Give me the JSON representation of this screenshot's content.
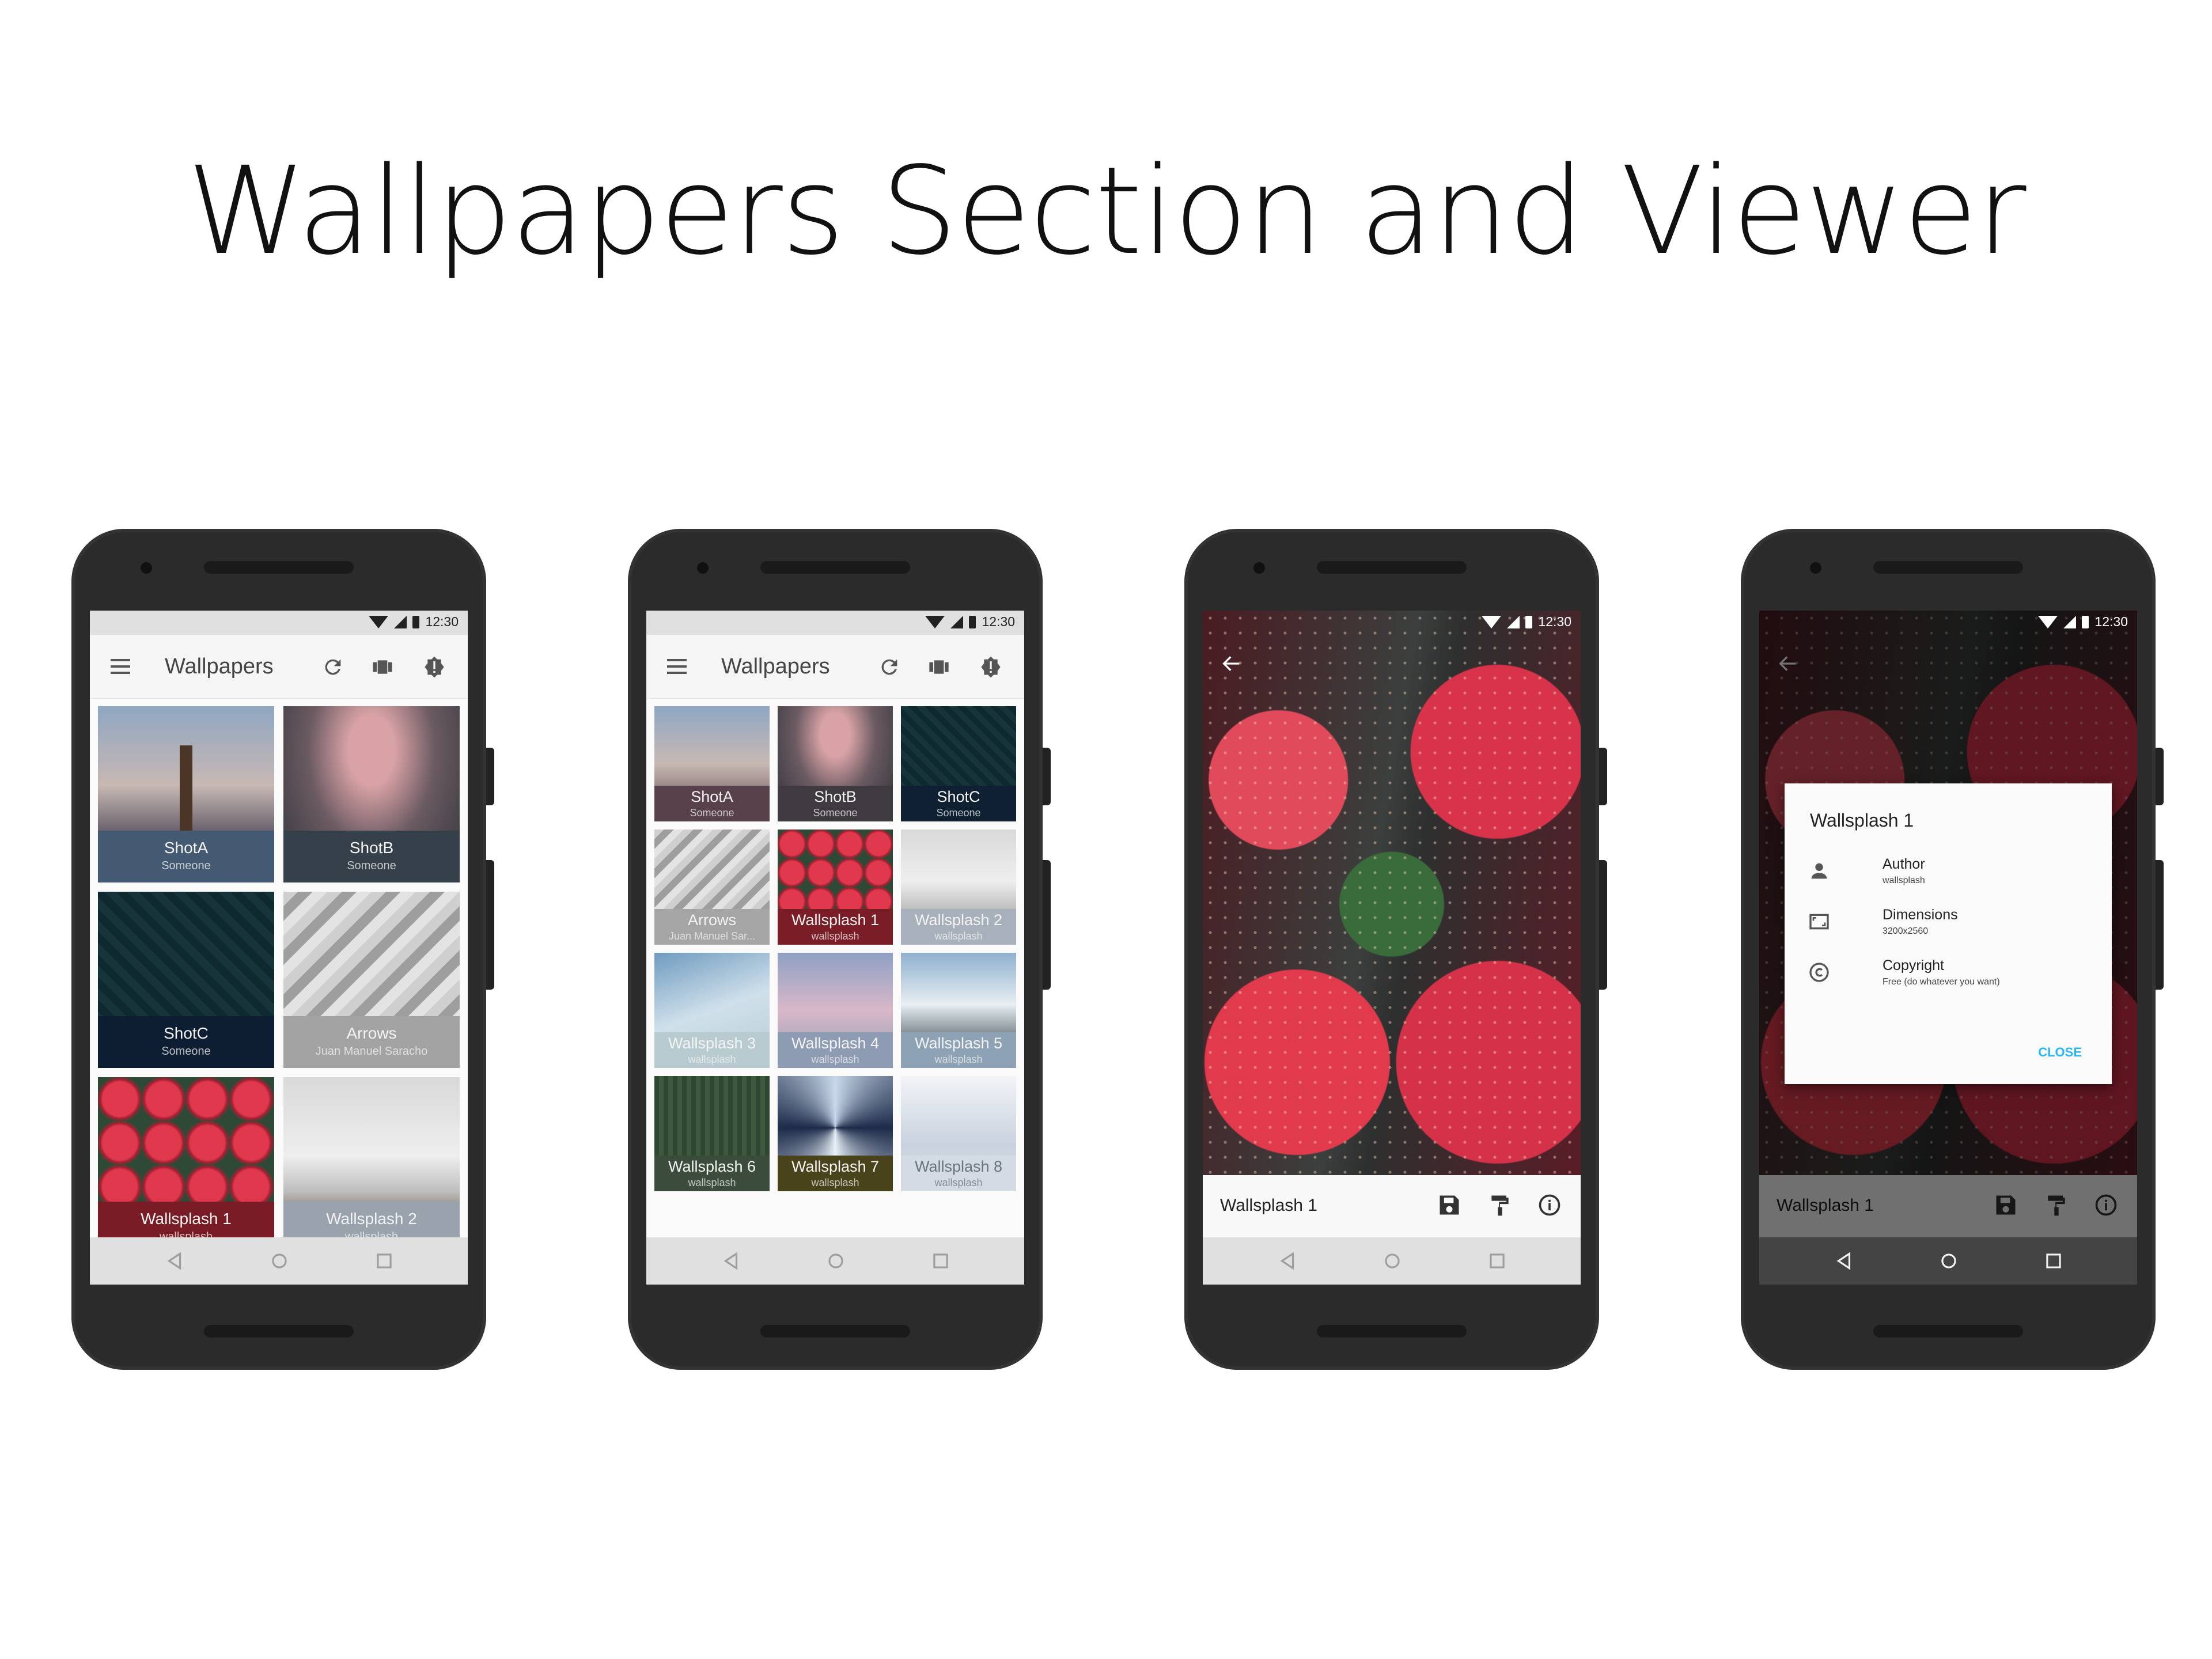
{
  "page_title": "Wallpapers Section and Viewer",
  "status": {
    "time": "12:30"
  },
  "appbar": {
    "title": "Wallpapers"
  },
  "grid_two_columns": [
    {
      "title": "ShotA",
      "subtitle": "Someone",
      "image": "city-dusk-tower",
      "color": "#445a72"
    },
    {
      "title": "ShotB",
      "subtitle": "Someone",
      "image": "night-sky-glow",
      "color": "#36404a"
    },
    {
      "title": "ShotC",
      "subtitle": "Someone",
      "image": "aerial-city-dark",
      "color": "#0d1e33"
    },
    {
      "title": "Arrows",
      "subtitle": "Juan Manuel Saracho",
      "image": "gray-chevron-pattern",
      "color": "#a3a3a3"
    },
    {
      "title": "Wallsplash 1",
      "subtitle": "wallsplash",
      "image": "strawberries",
      "color": "#7a1c25"
    },
    {
      "title": "Wallsplash 2",
      "subtitle": "wallsplash",
      "image": "misty-mountain",
      "color": "#9aa3ad"
    }
  ],
  "grid_three_columns": [
    {
      "title": "ShotA",
      "subtitle": "Someone",
      "image": "city-dusk-tower",
      "color": "#58414a"
    },
    {
      "title": "ShotB",
      "subtitle": "Someone",
      "image": "night-sky-glow",
      "color": "#3e3a3f"
    },
    {
      "title": "ShotC",
      "subtitle": "Someone",
      "image": "aerial-city-dark",
      "color": "#0e2031"
    },
    {
      "title": "Arrows",
      "subtitle": "Juan Manuel Sar...",
      "image": "gray-chevron-pattern",
      "color": "#a5a5a5"
    },
    {
      "title": "Wallsplash 1",
      "subtitle": "wallsplash",
      "image": "strawberries",
      "color": "#7b1d27"
    },
    {
      "title": "Wallsplash 2",
      "subtitle": "wallsplash",
      "image": "misty-mountain",
      "color": "#a8b1bb"
    },
    {
      "title": "Wallsplash 3",
      "subtitle": "wallsplash",
      "image": "blue-sky-clouds",
      "color": "#b7cbd1"
    },
    {
      "title": "Wallsplash 4",
      "subtitle": "wallsplash",
      "image": "pink-clouds",
      "color": "#8d9bb3"
    },
    {
      "title": "Wallsplash 5",
      "subtitle": "wallsplash",
      "image": "snowy-peaks",
      "color": "#8da2b4"
    },
    {
      "title": "Wallsplash 6",
      "subtitle": "wallsplash",
      "image": "forest",
      "color": "#3b4b3c"
    },
    {
      "title": "Wallsplash 7",
      "subtitle": "wallsplash",
      "image": "glass-roof",
      "color": "#49431b"
    },
    {
      "title": "Wallsplash 8",
      "subtitle": "wallsplash",
      "image": "white-architecture",
      "color": "#d5dbe5"
    }
  ],
  "viewer": {
    "title": "Wallsplash 1",
    "icons": [
      "back-arrow-icon",
      "save-icon",
      "paint-roller-icon",
      "info-icon"
    ]
  },
  "dialog": {
    "title": "Wallsplash 1",
    "rows": [
      {
        "label": "Author",
        "value": "wallsplash",
        "icon": "person-icon"
      },
      {
        "label": "Dimensions",
        "value": "3200x2560",
        "icon": "aspect-ratio-icon"
      },
      {
        "label": "Copyright",
        "value": "Free (do whatever you want)",
        "icon": "copyright-icon"
      }
    ],
    "close_label": "CLOSE",
    "accent": "#29b6f6"
  }
}
